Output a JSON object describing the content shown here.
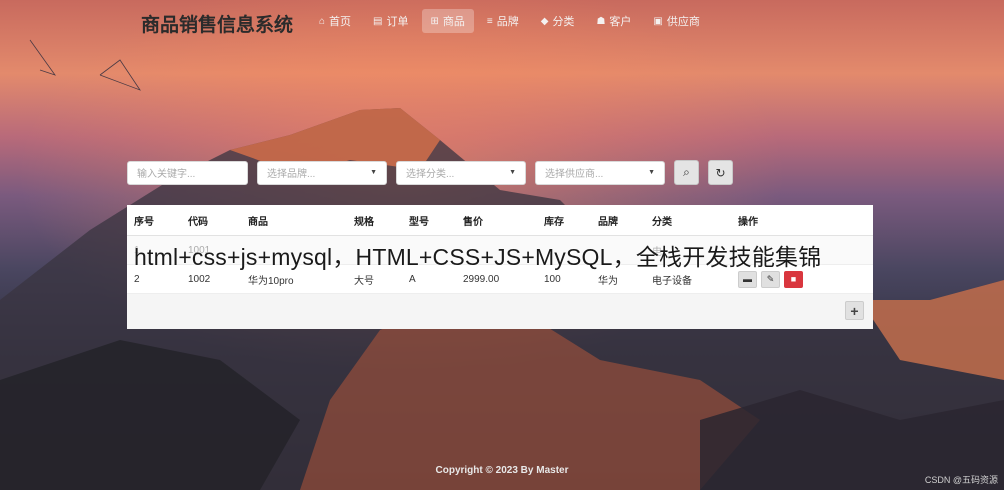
{
  "app_title": "商品销售信息系统",
  "nav": [
    {
      "icon": "home-icon",
      "glyph": "⌂",
      "label": "首页"
    },
    {
      "icon": "file-icon",
      "glyph": "▤",
      "label": "订单"
    },
    {
      "icon": "sitemap-icon",
      "glyph": "⊞",
      "label": "商品"
    },
    {
      "icon": "list-icon",
      "glyph": "≡",
      "label": "品牌"
    },
    {
      "icon": "tags-icon",
      "glyph": "◆",
      "label": "分类"
    },
    {
      "icon": "users-icon",
      "glyph": "☗",
      "label": "客户"
    },
    {
      "icon": "truck-icon",
      "glyph": "▣",
      "label": "供应商"
    }
  ],
  "filters": {
    "keyword_placeholder": "输入关键字...",
    "brand_placeholder": "选择品牌...",
    "category_placeholder": "选择分类...",
    "supplier_placeholder": "选择供应商..."
  },
  "table": {
    "headers": [
      "序号",
      "代码",
      "商品",
      "规格",
      "型号",
      "售价",
      "库存",
      "品牌",
      "分类",
      "操作"
    ],
    "rows": [
      [
        "1",
        "1001",
        "",
        "",
        "",
        "",
        "",
        "",
        "电",
        ""
      ],
      [
        "2",
        "1002",
        "华为10pro",
        "大号",
        "A",
        "2999.00",
        "100",
        "华为",
        "电子设备",
        ""
      ]
    ]
  },
  "overlay_text": "html+css+js+mysql，HTML+CSS+JS+MySQL，全栈开发技能集锦",
  "footer": "Copyright © 2023 By Master",
  "watermark": "CSDN @五码资源",
  "colors": {
    "delete": "#d9363e",
    "active_nav": "rgba(255,255,255,0.28)"
  }
}
